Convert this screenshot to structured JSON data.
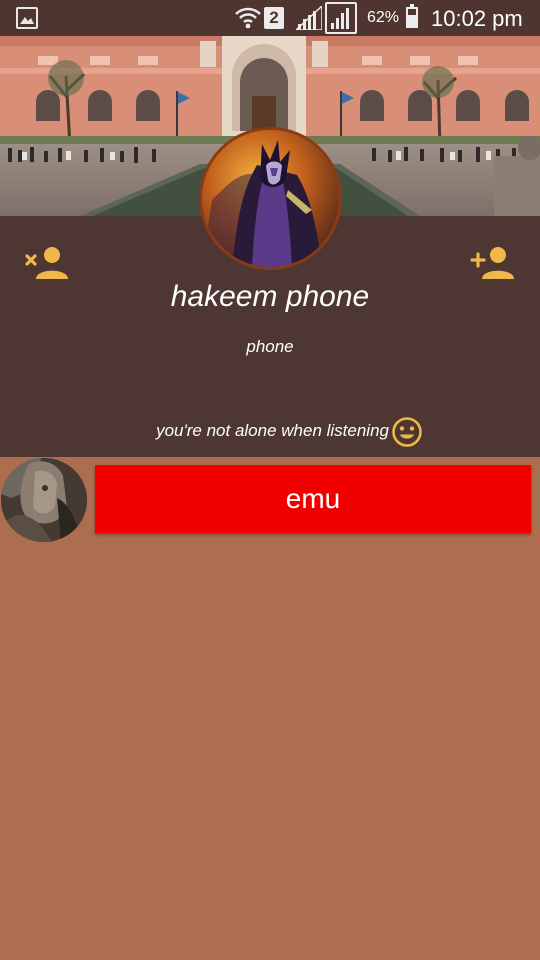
{
  "status_bar": {
    "sim_slot": "2",
    "battery_percent": "62%",
    "battery_level": 0.62,
    "time": "10:02 pm"
  },
  "profile": {
    "name": "hakeem phone",
    "subtitle": "phone",
    "tagline": "you're not alone when listening"
  },
  "colors": {
    "accent_icon": "#f0b74a",
    "panel": "#4e3632",
    "background": "#ad6e4f",
    "item_button": "#f10000"
  },
  "icons": {
    "left_action": "remove-person-icon",
    "right_action": "add-person-icon",
    "emoji": "smiley-icon"
  },
  "list": [
    {
      "label": "emu"
    }
  ]
}
